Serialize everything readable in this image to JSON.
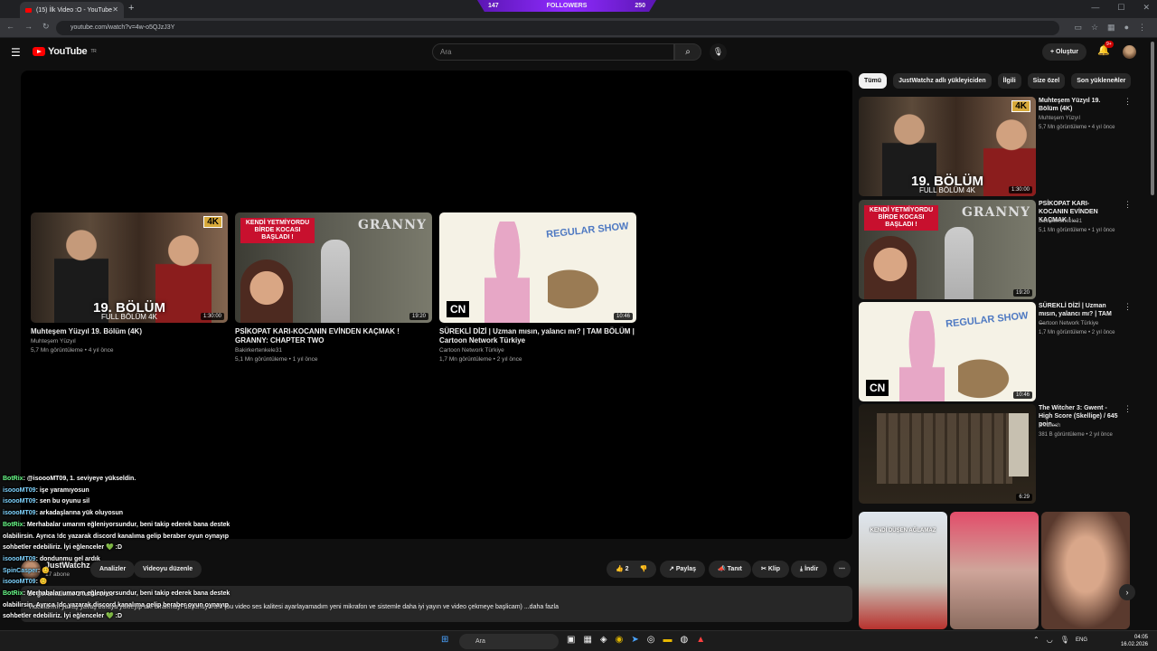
{
  "browser": {
    "tab_title": "(15) İlk Video :O - YouTube",
    "url": "youtube.com/watch?v=4w-o5QJzJ3Y",
    "new_tab_icon": "plus-icon",
    "close_icon": "close-icon"
  },
  "overlay": {
    "followers_left": "147",
    "followers_label": "FOLLOWERS",
    "followers_right": "250"
  },
  "masthead": {
    "logo": "YouTube",
    "country": "TR",
    "search_placeholder": "Ara",
    "create_label": "Oluştur",
    "notif_badge": "9+"
  },
  "end_cards": [
    {
      "title": "Muhteşem Yüzyıl 19. Bölüm (4K)",
      "channel": "Muhteşem Yüzyıl",
      "meta": "5,7 Mn görüntüleme • 4 yıl önce",
      "duration": "1:30:00",
      "cap1": "19. BÖLÜM",
      "cap2": "FULL BÖLÜM 4K",
      "badge": "4K"
    },
    {
      "title": "PSİKOPAT KARI-KOCANIN EVİNDEN KAÇMAK ! GRANNY: CHAPTER TWO",
      "channel": "Bakirkertenkele31",
      "meta": "5,1 Mn görüntüleme • 1 yıl önce",
      "duration": "19:20",
      "red": "KENDİ YETMİYORDU BİRDE KOCASI BAŞLADI !",
      "logo": "GRANNY"
    },
    {
      "title": "SÜREKLİ DİZİ | Uzman mısın, yalancı mı? | TAM BÖLÜM | Cartoon Network Türkiye",
      "channel": "Cartoon Network Türkiye",
      "meta": "1,7 Mn görüntüleme • 2 yıl önce",
      "duration": "10:46",
      "cn": "CN",
      "show": "REGULAR SHOW"
    }
  ],
  "video": {
    "channel": "JustWatchz",
    "subscribers": "17 abone",
    "analytics": "Analizler",
    "edit": "Videoyu düzenle",
    "likes": "2",
    "share": "Paylaş",
    "promote": "Tanıt",
    "clip": "Klip",
    "download": "İndir",
    "views_line": "24 görüntüleme  2 hafta önce",
    "description": "Videolarımı yavaş yavaş buraya yükleyip anı bırakmayı düşünüyorum (bu video ses kalitesi ayarlayamadım yeni mikrafon ve sistemle daha iyi yayın ve video çekmeye başlicam) ...daha fazla"
  },
  "chat": [
    {
      "user": "BotRix",
      "text": ": @isoooMT09, 1. seviyeye yükseldin.",
      "bot": true
    },
    {
      "user": "isoooMT09",
      "text": ": işe yaramıyosun",
      "bot": false
    },
    {
      "user": "isoooMT09",
      "text": ": sen bu oyunu sil",
      "bot": false
    },
    {
      "user": "isoooMT09",
      "text": ": arkadaşlarına yük oluyosun",
      "bot": false
    },
    {
      "user": "BotRix",
      "text": ": Merhabalar umarım eğleniyorsundur, beni takip ederek bana destek olabilirsin. Ayrıca !dc yazarak discord kanalıma gelip beraber oyun oynayıp sohbetler edebiliriz. İyi eğlenceler 💚 :D",
      "bot": true
    },
    {
      "user": "isoooMT09",
      "text": ": dondunmu gel ardık",
      "bot": false
    },
    {
      "user": "SpinCasper",
      "text": ": 😊",
      "bot": false
    },
    {
      "user": "isoooMT09",
      "text": ": 😊",
      "bot": false
    },
    {
      "user": "BotRix",
      "text": ": Merhabalar umarım eğleniyorsundur, beni takip ederek bana destek olabilirsin. Ayrıca !dc yazarak discord kanalıma gelip beraber oyun oynayıp sohbetler edebiliriz. İyi eğlenceler 💚 :D",
      "bot": true
    }
  ],
  "chips": [
    "Tümü",
    "JustWatchz adlı yükleyiciden",
    "İlgili",
    "Size özel",
    "Son yüklenenler"
  ],
  "recommendations": [
    {
      "title": "Muhteşem Yüzyıl 19. Bölüm (4K)",
      "channel": "Muhteşem Yüzyıl",
      "meta": "5,7 Mn görüntüleme • 4 yıl önce",
      "duration": "1:30:00"
    },
    {
      "title": "PSİKOPAT KARI-KOCANIN EVİNDEN KAÇMAK ! ...",
      "channel": "Bakirkertenkele31",
      "meta": "5,1 Mn görüntüleme • 1 yıl önce",
      "duration": "19:20"
    },
    {
      "title": "SÜREKLİ DİZİ | Uzman mısın, yalancı mı? | TAM ...",
      "channel": "Cartoon Network Türkiye",
      "meta": "1,7 Mn görüntüleme • 2 yıl önce",
      "duration": "10:46"
    },
    {
      "title": "The Witcher 3: Gwent - High Score (Skellige) / 645 poin...",
      "channel": "kretztech",
      "meta": "381 B görüntüleme • 2 yıl önce",
      "duration": "6:29"
    }
  ],
  "shorts_text": "KENDİ DÜŞEN AĞLAMAZ",
  "taskbar": {
    "search": "Ara",
    "lang": "ENG",
    "time": "04:05",
    "date": "16.02.2026"
  }
}
